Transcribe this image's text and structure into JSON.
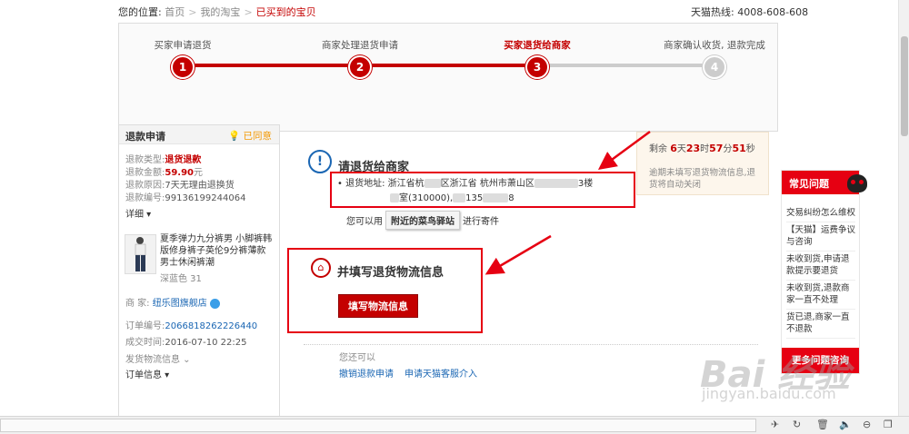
{
  "topbar": {
    "location_label": "您的位置:",
    "crumbs": [
      "首页",
      "我的淘宝",
      "已买到的宝贝"
    ],
    "hotline": "天猫热线: 4008-608-608"
  },
  "progress": {
    "steps": [
      {
        "label": "买家申请退货",
        "num": "1"
      },
      {
        "label": "商家处理退货申请",
        "num": "2"
      },
      {
        "label": "买家退货给商家",
        "num": "3"
      },
      {
        "label": "商家确认收货, 退款完成",
        "num": "4"
      }
    ],
    "current_step": 3
  },
  "refund": {
    "title": "退款申请",
    "agreed": "已同意",
    "type_label": "退款类型:",
    "type_value": "退货退款",
    "amount_label": "退款金额:",
    "amount_value": "59.90",
    "amount_unit": "元",
    "reason_label": "退款原因:",
    "reason_value": "7天无理由退换货",
    "id_label": "退款编号:",
    "id_value": "99136199244064",
    "detail": "详细 ▾",
    "product_desc": "夏季弹力九分裤男 小脚裤韩版修身裤子英伦9分裤薄款男士休闲裤潮",
    "product_color": "深蓝色 31",
    "seller_label": "商  家:",
    "seller_value": "纽乐图旗舰店",
    "order_no_label": "订单编号:",
    "order_no_value": "2066818262226440",
    "deal_time_label": "成交时间:",
    "deal_time_value": "2016-07-10 22:25",
    "ship_info": "发货物流信息 ⌄",
    "order_info": "订单信息 ▾"
  },
  "center": {
    "return_title": "请退货给商家",
    "addr_label": "退货地址:",
    "addr_line1_a": "浙江省杭",
    "addr_line1_b": "区浙江省 杭州市萧山区",
    "addr_line1_c": "3楼",
    "addr_line2_a": "室(310000),",
    "addr_line2_b": "135",
    "addr_line2_c": "8",
    "can_use": "您可以用",
    "nearby_btn": "附近的菜鸟驿站",
    "can_use_end": "进行寄件",
    "logistics_title": "并填写退货物流信息",
    "fill_btn": "填写物流信息",
    "also": "您还可以",
    "cancel_link": "撤销退款申请",
    "tmall_link": "申请天猫客服介入"
  },
  "countdown": {
    "prefix": "剩余",
    "days": "6",
    "days_unit": "天",
    "hours": "23",
    "hours_unit": "时",
    "minutes": "57",
    "minutes_unit": "分",
    "seconds": "51",
    "seconds_unit": "秒",
    "note": "逾期未填写退货物流信息,退货将自动关闭"
  },
  "faq": {
    "title": "常见问题",
    "items": [
      "交易纠纷怎么维权",
      "【天猫】运费争议与咨询",
      "未收到货,申请退款提示要退货",
      "未收到货,退款商家一直不处理",
      "货已退,商家一直不退款"
    ],
    "more": "更多问题咨询"
  },
  "watermark": {
    "main": "Bai 经验",
    "sub": "jingyan.baidu.com"
  },
  "colors": {
    "brand_red": "#c40000",
    "link_blue": "#1a66b3",
    "annotation_red": "#e60012"
  }
}
